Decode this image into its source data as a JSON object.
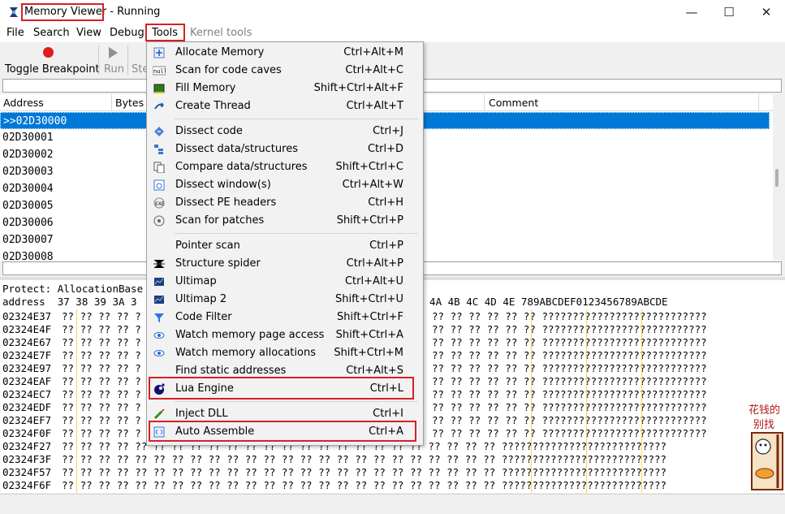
{
  "window": {
    "title": "Memory Viewer",
    "status": "- Running",
    "controls": {
      "minimize": "—",
      "maximize": "☐",
      "close": "✕"
    }
  },
  "menubar": [
    "File",
    "Search",
    "View",
    "Debug",
    "Tools",
    "Kernel tools"
  ],
  "toolbar": {
    "toggle_breakpoint": "Toggle Breakpoint",
    "run": "Run",
    "step_partial": "Ste"
  },
  "disassembler": {
    "columns": [
      "Address",
      "Bytes",
      "Comment"
    ],
    "rows": [
      ">>02D30000",
      "02D30001",
      "02D30002",
      "02D30003",
      "02D30004",
      "02D30005",
      "02D30006",
      "02D30007",
      "02D30008"
    ]
  },
  "hexview": {
    "protect_line": "Protect: AllocationBase",
    "header_left": "address  37 38 39 3A 3",
    "header_right": "9 4A 4B 4C 4D 4E 789ABCDEF0123456789ABCDE",
    "addresses": [
      "02324E37",
      "02324E4F",
      "02324E67",
      "02324E7F",
      "02324E97",
      "02324EAF",
      "02324EC7",
      "02324EDF",
      "02324EF7",
      "02324F0F",
      "02324F27",
      "02324F3F",
      "02324F57",
      "02324F6F"
    ],
    "left_cells": "?? ?? ?? ?? ?",
    "right_cells": "?? ?? ?? ?? ?? ?? ???????????????????????????",
    "full_row": "?? ?? ?? ?? ?? ?? ?? ?? ?? ?? ?? ?? ?? ?? ?? ?? ?? ?? ?? ?? ?? ?? ?? ?? ???????????????????????????"
  },
  "tools_menu": {
    "groups": [
      [
        {
          "icon": "allocate-icon",
          "label": "Allocate Memory",
          "shortcut": "Ctrl+Alt+M"
        },
        {
          "icon": "null-scan-icon",
          "label": "Scan for code caves",
          "shortcut": "Ctrl+Alt+C"
        },
        {
          "icon": "fill-icon",
          "label": "Fill Memory",
          "shortcut": "Shift+Ctrl+Alt+F"
        },
        {
          "icon": "thread-icon",
          "label": "Create Thread",
          "shortcut": "Ctrl+Alt+T"
        }
      ],
      [
        {
          "icon": "dissect-code-icon",
          "label": "Dissect code",
          "shortcut": "Ctrl+J"
        },
        {
          "icon": "structures-icon",
          "label": "Dissect data/structures",
          "shortcut": "Ctrl+D"
        },
        {
          "icon": "compare-icon",
          "label": "Compare data/structures",
          "shortcut": "Shift+Ctrl+C"
        },
        {
          "icon": "window-icon",
          "label": "Dissect window(s)",
          "shortcut": "Ctrl+Alt+W"
        },
        {
          "icon": "pe-icon",
          "label": "Dissect PE headers",
          "shortcut": "Ctrl+H"
        },
        {
          "icon": "patch-icon",
          "label": "Scan for patches",
          "shortcut": "Shift+Ctrl+P"
        }
      ],
      [
        {
          "icon": "pointer-icon",
          "label": "Pointer scan",
          "shortcut": "Ctrl+P"
        },
        {
          "icon": "spider-icon",
          "label": "Structure spider",
          "shortcut": "Ctrl+Alt+P"
        },
        {
          "icon": "ultimap-icon",
          "label": "Ultimap",
          "shortcut": "Ctrl+Alt+U"
        },
        {
          "icon": "ultimap2-icon",
          "label": "Ultimap 2",
          "shortcut": "Shift+Ctrl+U"
        },
        {
          "icon": "filter-icon",
          "label": "Code Filter",
          "shortcut": "Shift+Ctrl+F"
        },
        {
          "icon": "eye-icon",
          "label": "Watch memory page access",
          "shortcut": "Shift+Ctrl+A"
        },
        {
          "icon": "eye-icon",
          "label": "Watch memory allocations",
          "shortcut": "Shift+Ctrl+M"
        },
        {
          "icon": "",
          "label": "Find static addresses",
          "shortcut": "Ctrl+Alt+S"
        },
        {
          "icon": "lua-icon",
          "label": "Lua Engine",
          "shortcut": "Ctrl+L"
        }
      ],
      [
        {
          "icon": "syringe-icon",
          "label": "Inject DLL",
          "shortcut": "Ctrl+I"
        },
        {
          "icon": "assemble-icon",
          "label": "Auto Assemble",
          "shortcut": "Ctrl+A"
        }
      ]
    ]
  },
  "sticker": {
    "text": "花钱的别找"
  },
  "colors": {
    "selection": "#0078d7",
    "highlight": "#d62027",
    "hex_separator": "#f5d65a"
  }
}
